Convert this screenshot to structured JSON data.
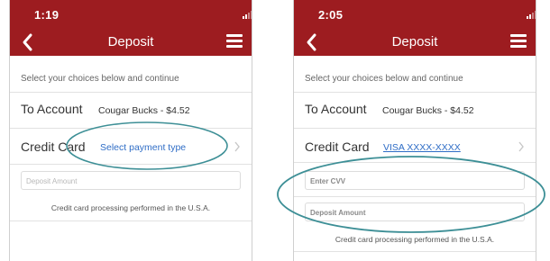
{
  "colors": {
    "header": "#9d1c20",
    "link": "#2f6dc6",
    "annotation": "#3d8f96"
  },
  "icons": {
    "back": "chevron-left-icon",
    "menu": "hamburger-menu-icon",
    "row_chevron": "chevron-right-icon",
    "signal": "cellular-signal-icon",
    "wifi": "wifi-icon",
    "battery": "battery-icon"
  },
  "screens": [
    {
      "status_time": "1:19",
      "title": "Deposit",
      "instructions": "Select your choices below and continue",
      "to_account": {
        "label": "To Account",
        "value": "Cougar Bucks - $4.52"
      },
      "credit_card": {
        "label": "Credit Card",
        "value": "Select payment type"
      },
      "deposit_placeholder": "Deposit Amount",
      "note": "Credit card processing performed in the U.S.A."
    },
    {
      "status_time": "2:05",
      "title": "Deposit",
      "instructions": "Select your choices below and continue",
      "to_account": {
        "label": "To Account",
        "value": "Cougar Bucks - $4.52"
      },
      "credit_card": {
        "label": "Credit Card",
        "value": "VISA XXXX-XXXX"
      },
      "cvv_placeholder": "Enter CVV",
      "deposit_placeholder": "Deposit Amount",
      "note": "Credit card processing performed in the U.S.A."
    }
  ]
}
